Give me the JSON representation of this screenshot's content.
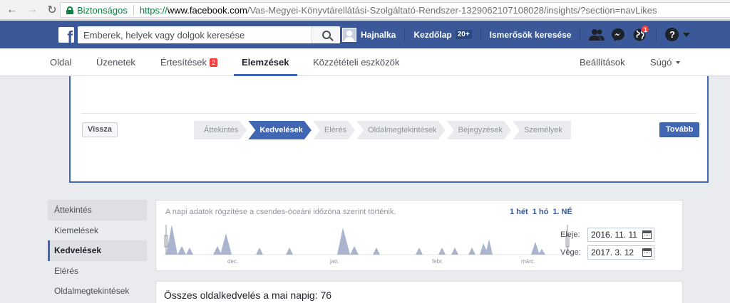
{
  "browser": {
    "secure_label": "Biztonságos",
    "url_protocol": "https://",
    "url_host": "www.facebook.com",
    "url_path": "/Vas-Megyei-Könyvtárellátási-Szolgáltató-Rendszer-1329062107108028/insights/?section=navLikes"
  },
  "topbar": {
    "logo_letter": "f",
    "search_placeholder": "Emberek, helyek vagy dolgok keresése",
    "user_name": "Hajnalka",
    "home_label": "Kezdőlap",
    "home_count": "20+",
    "find_friends_label": "Ismerősök keresése",
    "notifications_count": "1",
    "help_glyph": "?"
  },
  "page_nav": {
    "items": [
      {
        "label": "Oldal"
      },
      {
        "label": "Üzenetek"
      },
      {
        "label": "Értesítések",
        "badge": "2"
      },
      {
        "label": "Elemzések"
      },
      {
        "label": "Közzétételi eszközök"
      }
    ],
    "settings_label": "Beállítások",
    "help_label": "Súgó"
  },
  "tour": {
    "back_label": "Vissza",
    "next_label": "Tovább",
    "steps": [
      "Áttekintés",
      "Kedvelések",
      "Elérés",
      "Oldalmegtekintések",
      "Bejegyzések",
      "Személyek"
    ],
    "active_step": "Kedvelések"
  },
  "sidebar": {
    "items": [
      "Áttekintés",
      "Kiemelések",
      "Kedvelések",
      "Elérés",
      "Oldalmegtekintések"
    ],
    "active": "Kedvelések"
  },
  "chart_card": {
    "note": "A napi adatok rögzítése a csendes-óceáni időzóna szerint történik.",
    "ranges": [
      "1 hét",
      "1 hó",
      "1. NÉ"
    ],
    "selected_range": "1. NÉ",
    "start_label": "Eleje:",
    "start_date": "2016. 11. 11",
    "end_label": "Vége:",
    "end_date": "2017. 3. 12"
  },
  "chart_data": {
    "type": "area",
    "months": [
      "dec.",
      "jan.",
      "febr.",
      "márc."
    ],
    "color": "#aab4cf"
  },
  "total": {
    "text": "Összes oldalkedvelés a mai napig: 76"
  }
}
